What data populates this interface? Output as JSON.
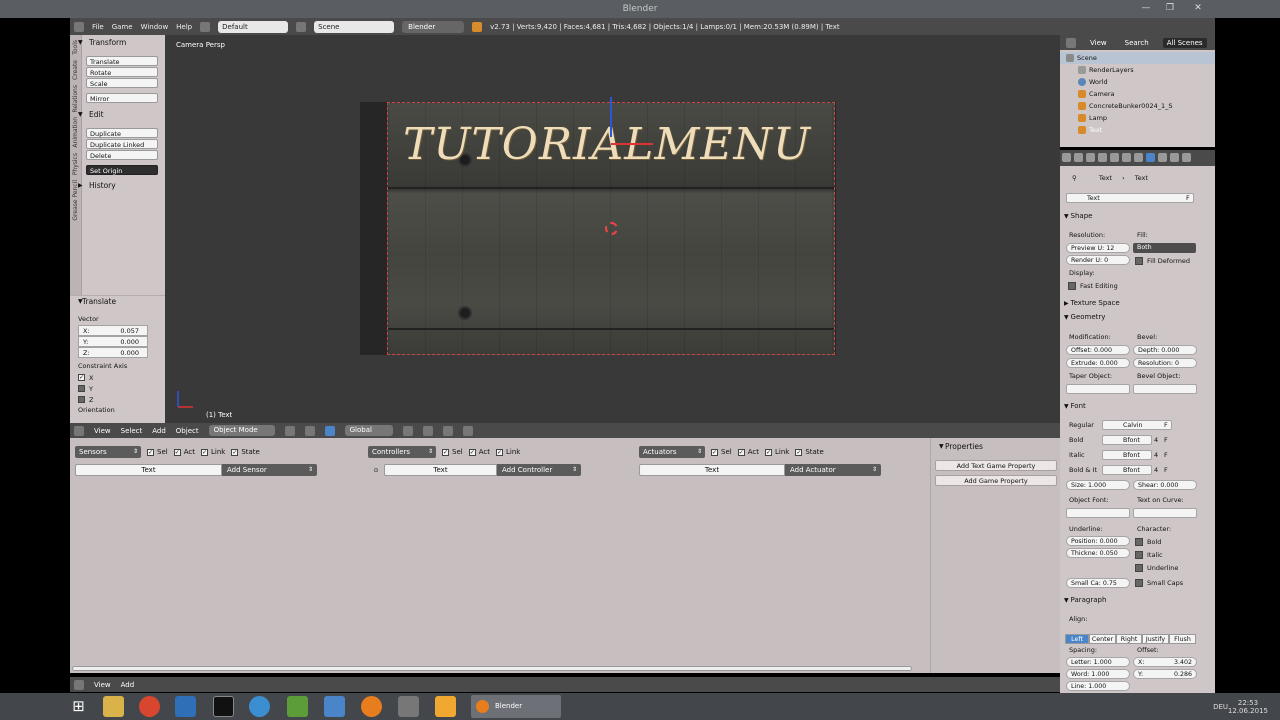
{
  "window": {
    "title": "Blender",
    "min": "—",
    "max": "❐",
    "close": "✕"
  },
  "info_header": {
    "menus": [
      "File",
      "Game",
      "Window",
      "Help"
    ],
    "layout": "Default",
    "scene": "Scene",
    "engine": "Blender Game",
    "stats": "v2.73 | Verts:9,420 | Faces:4,681 | Tris:4,682 | Objects:1/4 | Lamps:0/1 | Mem:20.53M (0.89M) | Text"
  },
  "toolshelf": {
    "tabs": [
      "Tools",
      "Create",
      "Relations",
      "Animation",
      "Physics",
      "Grease Pencil"
    ],
    "transform_title": "Transform",
    "transform_buttons": [
      "Translate",
      "Rotate",
      "Scale",
      "Mirror"
    ],
    "edit_title": "Edit",
    "edit_buttons": [
      "Duplicate",
      "Duplicate Linked",
      "Delete"
    ],
    "set_origin": "Set Origin",
    "history_title": "History"
  },
  "redo_panel": {
    "title": "Translate",
    "vector_label": "Vector",
    "vector": [
      {
        "axis": "X:",
        "value": "0.057"
      },
      {
        "axis": "Y:",
        "value": "0.000"
      },
      {
        "axis": "Z:",
        "value": "0.000"
      }
    ],
    "constraint_label": "Constraint Axis",
    "constraints": [
      {
        "axis": "X",
        "checked": true
      },
      {
        "axis": "Y",
        "checked": false
      },
      {
        "axis": "Z",
        "checked": false
      }
    ],
    "orientation_label": "Orientation"
  },
  "viewport": {
    "view_label": "Camera Persp",
    "object_label": "(1) Text",
    "scene_text": "TUTORIALMENU"
  },
  "viewport_header": {
    "menus": [
      "View",
      "Select",
      "Add",
      "Object"
    ],
    "mode": "Object Mode",
    "orientation": "Global"
  },
  "logic": {
    "sensors": {
      "dropdown": "Sensors",
      "sel": "Sel",
      "act": "Act",
      "link": "Link",
      "state": "State",
      "field": "Text",
      "add": "Add Sensor"
    },
    "controllers": {
      "dropdown": "Controllers",
      "sel": "Sel",
      "act": "Act",
      "link": "Link",
      "field": "Text",
      "add": "Add Controller"
    },
    "actuators": {
      "dropdown": "Actuators",
      "sel": "Sel",
      "act": "Act",
      "link": "Link",
      "state": "State",
      "field": "Text",
      "add": "Add Actuator"
    },
    "properties_title": "Properties",
    "add_text_prop": "Add Text Game Property",
    "add_game_prop": "Add Game Property"
  },
  "logic_header": {
    "menus": [
      "View",
      "Add"
    ]
  },
  "outliner": {
    "tabs": [
      "View",
      "Search",
      "All Scenes"
    ],
    "items": [
      {
        "name": "Scene",
        "indent": 0
      },
      {
        "name": "RenderLayers",
        "indent": 1
      },
      {
        "name": "World",
        "indent": 1
      },
      {
        "name": "Camera",
        "indent": 1
      },
      {
        "name": "ConcreteBunker0024_1_S",
        "indent": 1
      },
      {
        "name": "Lamp",
        "indent": 1
      },
      {
        "name": "Text",
        "indent": 1
      }
    ]
  },
  "properties": {
    "breadcrumb": [
      "Text",
      "Text"
    ],
    "datablock": "Text",
    "datablock_flag": "F",
    "shape": {
      "title": "Shape",
      "resolution_label": "Resolution:",
      "preview_u": "Preview U: 12",
      "render_u": "Render U: 0",
      "fill_label": "Fill:",
      "fill_value": "Both",
      "fill_deformed": "Fill Deformed",
      "display_label": "Display:",
      "fast_editing": "Fast Editing"
    },
    "texture_space": "Texture Space",
    "geometry": {
      "title": "Geometry",
      "modification_label": "Modification:",
      "offset": "Offset: 0.000",
      "extrude": "Extrude: 0.000",
      "bevel_label": "Bevel:",
      "depth": "Depth: 0.000",
      "bevel_resolution": "Resolution: 0",
      "taper_label": "Taper Object:",
      "bevel_object_label": "Bevel Object:"
    },
    "font": {
      "title": "Font",
      "rows": [
        {
          "label": "Regular",
          "value": "Calvin",
          "flag": "F"
        },
        {
          "label": "Bold",
          "value": "Bfont",
          "num": "4",
          "flag": "F"
        },
        {
          "label": "Italic",
          "value": "Bfont",
          "num": "4",
          "flag": "F"
        },
        {
          "label": "Bold & It",
          "value": "Bfont",
          "num": "4",
          "flag": "F"
        }
      ],
      "size": "Size: 1.000",
      "shear": "Shear: 0.000",
      "object_font_label": "Object Font:",
      "text_on_curve_label": "Text on Curve:",
      "underline_label": "Underline:",
      "position": "Position: 0.000",
      "thickness": "Thickne: 0.050",
      "character_label": "Character:",
      "bold": "Bold",
      "italic": "Italic",
      "underline": "Underline",
      "small_caps_scale": "Small Ca: 0.75",
      "small_caps": "Small Caps"
    },
    "paragraph": {
      "title": "Paragraph",
      "align_label": "Align:",
      "align": [
        "Left",
        "Center",
        "Right",
        "Justify",
        "Flush"
      ],
      "align_active": "Left",
      "spacing_label": "Spacing:",
      "letter": "Letter: 1.000",
      "word": "Word: 1.000",
      "line": "Line: 1.000",
      "offset_label": "Offset:",
      "offset_x_axis": "X:",
      "offset_x_value": "3.402",
      "offset_y_axis": "Y:",
      "offset_y_value": "0.286"
    }
  },
  "taskbar": {
    "blender_label": "Blender",
    "language": "DEU",
    "time": "22:53",
    "date": "12.06.2015"
  },
  "colors": {
    "blender_blue": "#4a84c9",
    "panel_bg": "#cfc7c7",
    "header_bg": "#4a4a4a",
    "text_cream": "#efdcb9"
  }
}
